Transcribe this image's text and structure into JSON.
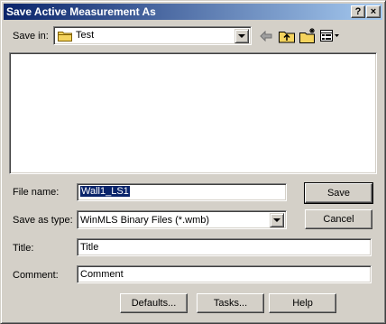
{
  "window": {
    "title": "Save Active Measurement As",
    "help_button": "?",
    "close_button": "×"
  },
  "save_in": {
    "label": "Save in:",
    "value": "Test"
  },
  "toolbar": {
    "icons": [
      "back-arrow-icon",
      "up-folder-icon",
      "new-folder-icon",
      "view-menu-icon"
    ]
  },
  "file_name": {
    "label": "File name:",
    "value": "Wall1_LS1"
  },
  "save_as_type": {
    "label": "Save as type:",
    "value": "WinMLS Binary Files (*.wmb)"
  },
  "title_field": {
    "label": "Title:",
    "value": "Title"
  },
  "comment_field": {
    "label": "Comment:",
    "value": "Comment"
  },
  "buttons": {
    "save": "Save",
    "cancel": "Cancel",
    "defaults": "Defaults...",
    "tasks": "Tasks...",
    "help": "Help"
  },
  "colors": {
    "titlebar_start": "#0a246a",
    "titlebar_end": "#a6caf0",
    "face": "#d4d0c8",
    "selection": "#0a246a",
    "folder": "#f4d35e"
  }
}
